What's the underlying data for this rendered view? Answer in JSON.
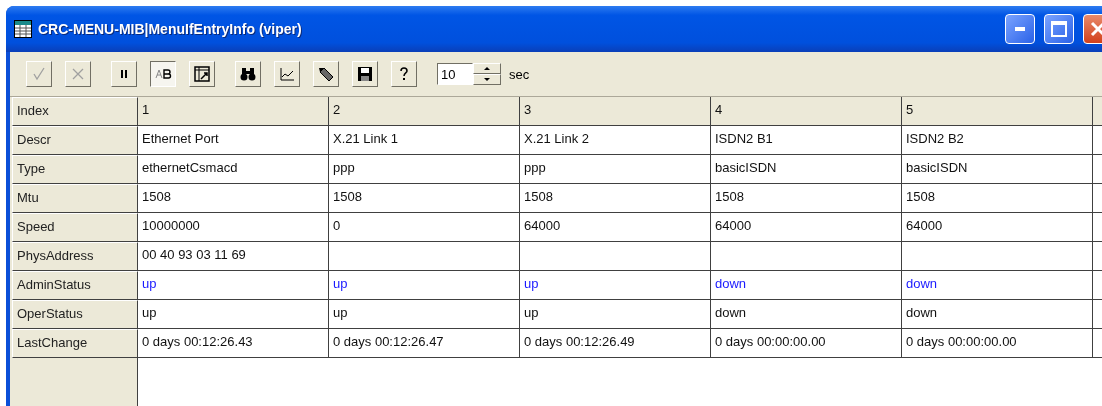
{
  "window": {
    "title": "CRC-MENU-MIB|MenuIfEntryInfo (viper)"
  },
  "toolbar": {
    "groups": [
      [
        {
          "kind": "check",
          "disabled": true,
          "pressed": false
        },
        {
          "kind": "cancel",
          "disabled": true,
          "pressed": false
        }
      ],
      [
        {
          "kind": "pause",
          "disabled": false,
          "pressed": false
        },
        {
          "kind": "font",
          "disabled": false,
          "pressed": true
        },
        {
          "kind": "expand",
          "disabled": false,
          "pressed": false
        }
      ],
      [
        {
          "kind": "find",
          "disabled": false,
          "pressed": false
        },
        {
          "kind": "chart",
          "disabled": false,
          "pressed": false
        },
        {
          "kind": "edit",
          "disabled": false,
          "pressed": false
        },
        {
          "kind": "save",
          "disabled": false,
          "pressed": false
        },
        {
          "kind": "help",
          "disabled": false,
          "pressed": false
        }
      ]
    ],
    "interval": {
      "value": "10",
      "unit": "sec"
    }
  },
  "table": {
    "rows": [
      {
        "label": "Index",
        "kind": "header",
        "cells": [
          "1",
          "2",
          "3",
          "4",
          "5"
        ]
      },
      {
        "label": "Descr",
        "kind": "value",
        "cells": [
          "Ethernet Port",
          "X.21 Link 1",
          "X.21 Link 2",
          "ISDN2 B1",
          "ISDN2 B2"
        ]
      },
      {
        "label": "Type",
        "kind": "value",
        "cells": [
          "ethernetCsmacd",
          "ppp",
          "ppp",
          "basicISDN",
          "basicISDN"
        ]
      },
      {
        "label": "Mtu",
        "kind": "value",
        "cells": [
          "1508",
          "1508",
          "1508",
          "1508",
          "1508"
        ]
      },
      {
        "label": "Speed",
        "kind": "value",
        "cells": [
          "10000000",
          "0",
          "64000",
          "64000",
          "64000"
        ]
      },
      {
        "label": "PhysAddress",
        "kind": "value",
        "cells": [
          "00 40 93 03 11 69",
          null,
          null,
          null,
          null
        ]
      },
      {
        "label": "AdminStatus",
        "kind": "editable",
        "cells": [
          "up",
          "up",
          "up",
          "down",
          "down"
        ]
      },
      {
        "label": "OperStatus",
        "kind": "value",
        "cells": [
          "up",
          "up",
          "up",
          "down",
          "down"
        ]
      },
      {
        "label": "LastChange",
        "kind": "value",
        "cells": [
          "0 days 00:12:26.43",
          "0 days 00:12:26.47",
          "0 days 00:12:26.49",
          "0 days 00:00:00.00",
          "0 days 00:00:00.00"
        ]
      }
    ]
  }
}
